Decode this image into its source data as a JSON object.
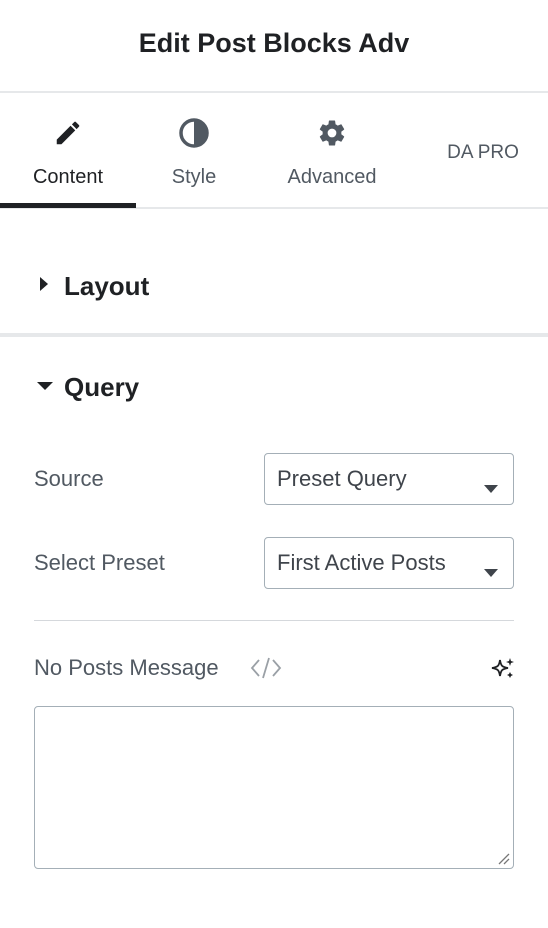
{
  "header": {
    "title": "Edit Post Blocks Adv"
  },
  "tabs": [
    {
      "label": "Content",
      "icon": "pencil-icon",
      "active": true
    },
    {
      "label": "Style",
      "icon": "half-circle-icon",
      "active": false
    },
    {
      "label": "Advanced",
      "icon": "gear-icon",
      "active": false
    },
    {
      "label": "DA PRO",
      "icon": "",
      "active": false
    }
  ],
  "sections": {
    "layout": {
      "title": "Layout",
      "expanded": false
    },
    "query": {
      "title": "Query",
      "expanded": true,
      "source": {
        "label": "Source",
        "value": "Preset Query"
      },
      "preset": {
        "label": "Select Preset",
        "value": "First Active Posts"
      },
      "no_posts": {
        "label": "No Posts Message",
        "value": ""
      }
    }
  },
  "colors": {
    "text": "#1f2124",
    "muted": "#515962",
    "border": "#a4afb7",
    "divider": "#e6e8ea"
  }
}
